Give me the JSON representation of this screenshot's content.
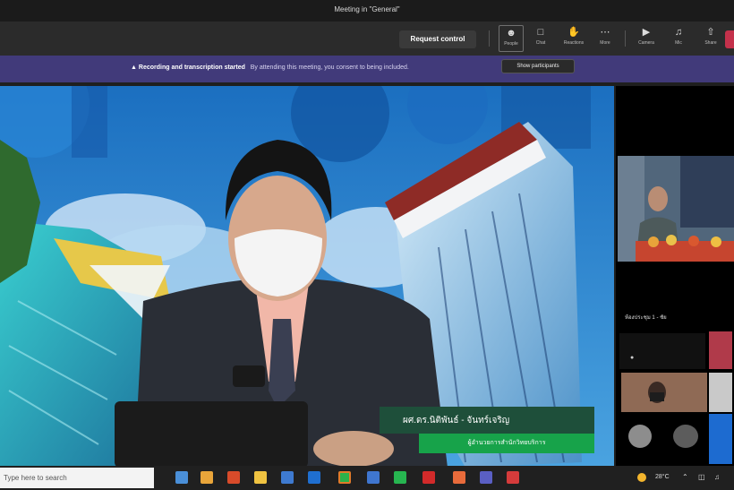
{
  "window": {
    "title": "Meeting in \"General\""
  },
  "toolbar": {
    "request_control": "Request control",
    "people": "People",
    "chat": "Chat",
    "reactions": "Reactions",
    "more": "More",
    "camera": "Camera",
    "mic": "Mic",
    "share": "Share",
    "tooltip": "Show participants"
  },
  "banner": {
    "bold_text": "Recording and transcription started",
    "rest_text": "By attending this meeting, you consent to being included.",
    "icon": "warning-icon"
  },
  "speaker": {
    "name": "ผศ.ดร.นิติพันธ์ - จันทร์เจริญ",
    "role": "ผู้อำนวยการสำนักวิทยบริการ"
  },
  "participants": {
    "tile_label": "ห้องประชุม 1 - ชัย"
  },
  "taskbar": {
    "search_placeholder": "Type here to search",
    "temperature": "28°C"
  },
  "colors": {
    "banner": "#413a7a",
    "name_bar": "#1e4f3a",
    "role_bar": "#17a34a",
    "leave": "#c4314b"
  }
}
